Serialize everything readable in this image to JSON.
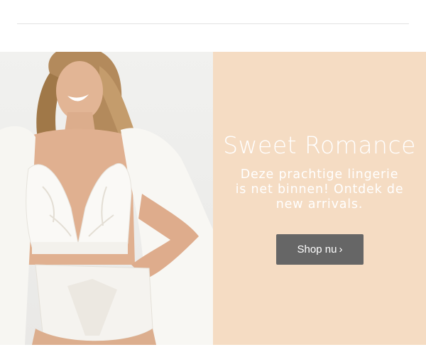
{
  "banner": {
    "title": "Sweet Romance",
    "subtitle": "Deze prachtige lingerie is net binnen! Ontdek de new arrivals.",
    "cta_label": "Shop nu",
    "cta_chevron": "›",
    "image_icon": "lingerie-model-photo"
  },
  "colors": {
    "promo_background": "#f5dcc3",
    "button_background": "#666666",
    "text": "#ffffff"
  }
}
